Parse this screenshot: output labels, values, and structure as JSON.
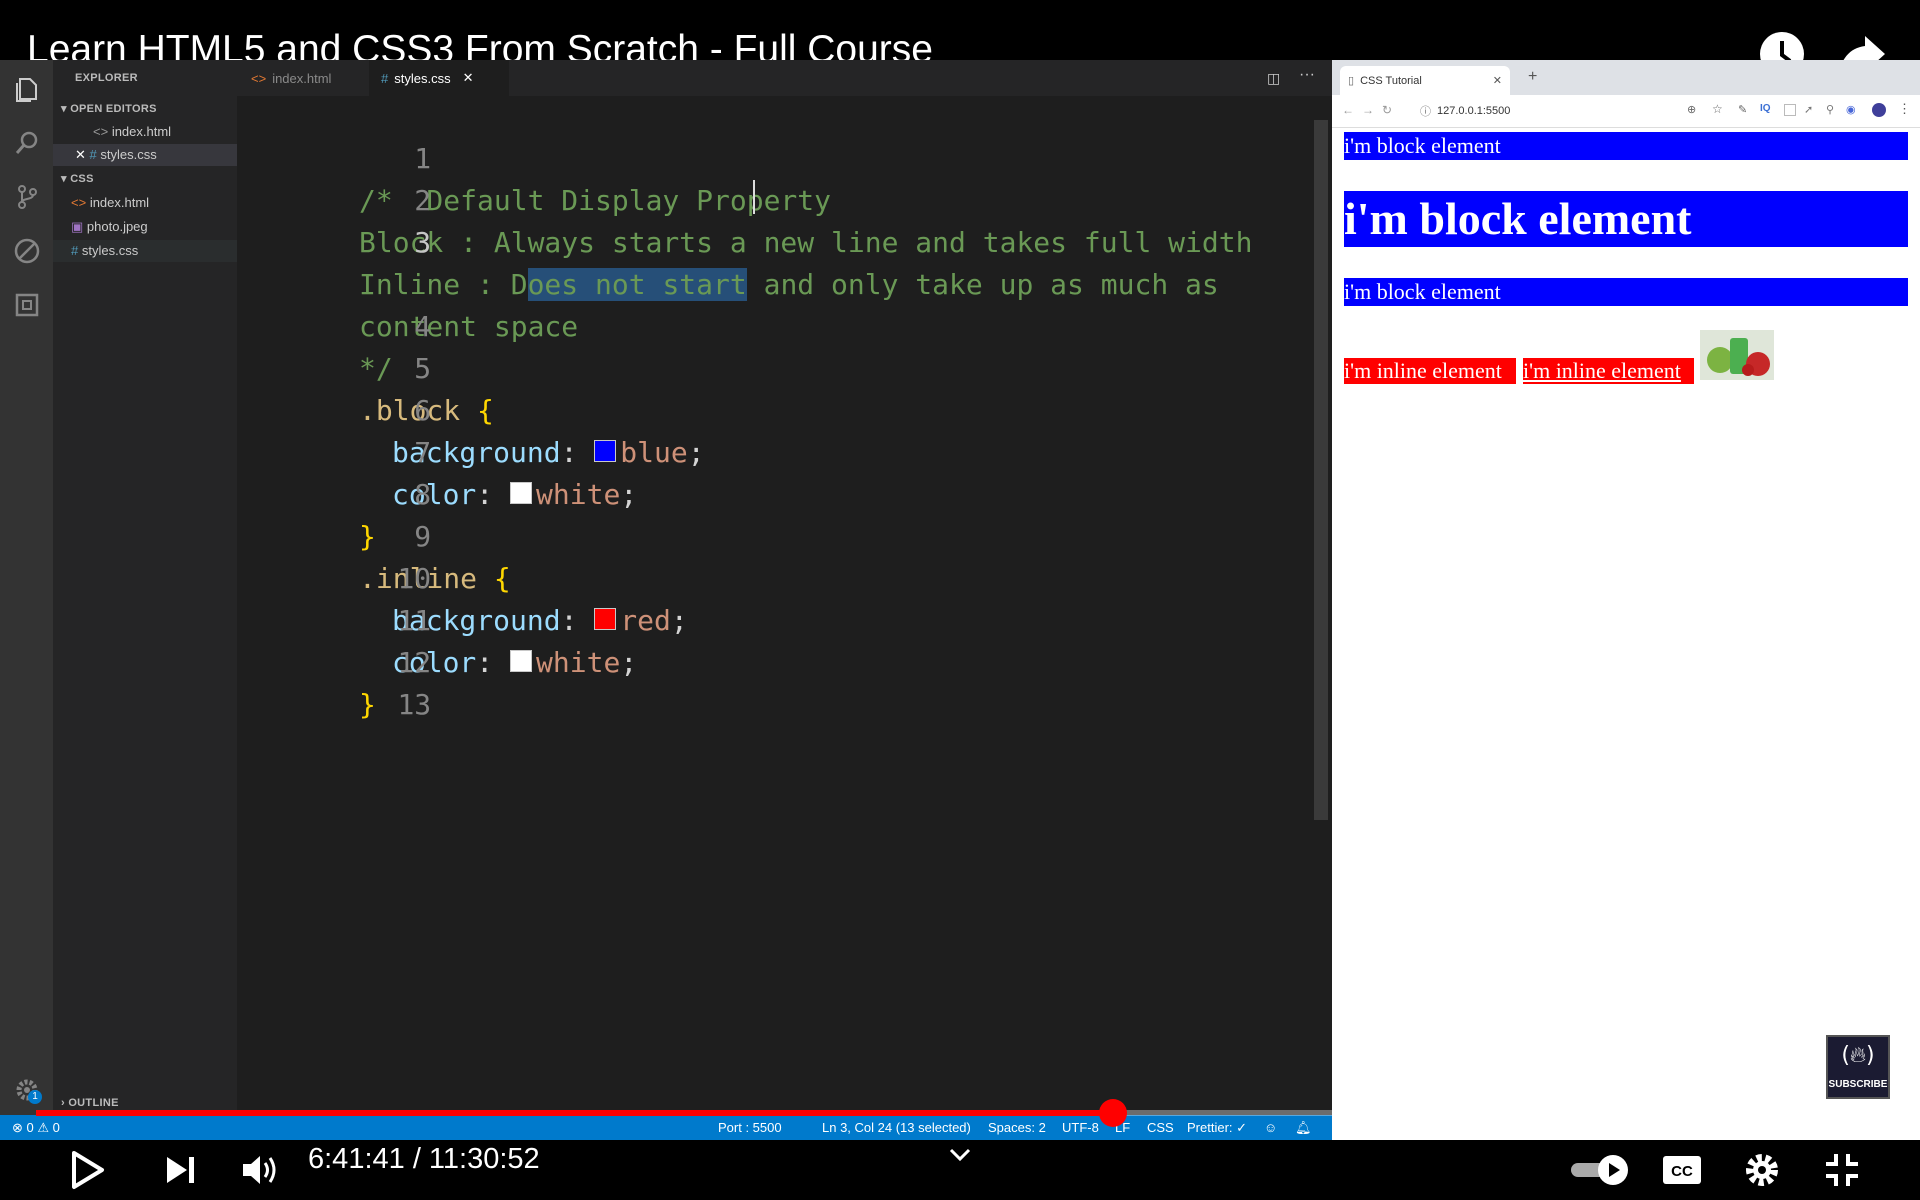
{
  "video": {
    "title": "Learn HTML5 and CSS3 From Scratch - Full Course",
    "time": "6:41:41 / 11:30:52",
    "progress_percent": 58.2
  },
  "vscode": {
    "sidebar": {
      "explorer_label": "EXPLORER",
      "open_editors_label": "OPEN EDITORS",
      "open_editors": [
        "index.html",
        "styles.css"
      ],
      "folder_label": "CSS",
      "files": [
        "index.html",
        "photo.jpeg",
        "styles.css"
      ],
      "outline_label": "OUTLINE"
    },
    "tabs": [
      "index.html",
      "styles.css"
    ],
    "active_tab": "styles.css",
    "code_lines": [
      {
        "num": "1"
      },
      {
        "num": "2"
      },
      {
        "num": "3"
      },
      {
        "num": ""
      },
      {
        "num": "4"
      },
      {
        "num": "5"
      },
      {
        "num": "6"
      },
      {
        "num": "7"
      },
      {
        "num": "8"
      },
      {
        "num": "9"
      },
      {
        "num": "10"
      },
      {
        "num": "11"
      },
      {
        "num": "12"
      },
      {
        "num": "13"
      }
    ],
    "code": {
      "l1": "/*  Default Display Property",
      "l2": "Block : Always starts a new line and takes full width",
      "l3_pre": "Inline : D",
      "l3_sel": "oes not start",
      "l3_post": " and only take up as much as",
      "l3_wrap": "content space",
      "l4": "*/",
      "l5_sel": ".block",
      "l5_brace": " {",
      "l6_prop": "background",
      "l6_val": "blue",
      "l7_prop": "color",
      "l7_val": "white",
      "l8": "}",
      "l9_sel": ".inline",
      "l9_brace": " {",
      "l10_prop": "background",
      "l10_val": "red",
      "l11_prop": "color",
      "l11_val": "white",
      "l12": "}",
      "colon": ": ",
      "semi": ";"
    },
    "status": {
      "errors": "0",
      "warnings": "0",
      "port": "Port : 5500",
      "position": "Ln 3, Col 24 (13 selected)",
      "spaces": "Spaces: 2",
      "encoding": "UTF-8",
      "eol": "LF",
      "language": "CSS",
      "prettier": "Prettier: ✓"
    },
    "colors": {
      "status_bar": "#007acc",
      "editor_bg": "#1e1e1e"
    }
  },
  "browser": {
    "tab_title": "CSS Tutorial",
    "url": "127.0.0.1:5500",
    "blocks": [
      "i'm block element",
      "i'm block element",
      "i'm block element"
    ],
    "inlines": [
      "i'm inline element",
      "i'm inline element"
    ],
    "colors": {
      "block": "#0000ff",
      "inline": "#ff0000"
    }
  },
  "logo": {
    "text": "SUBSCRIBE"
  }
}
